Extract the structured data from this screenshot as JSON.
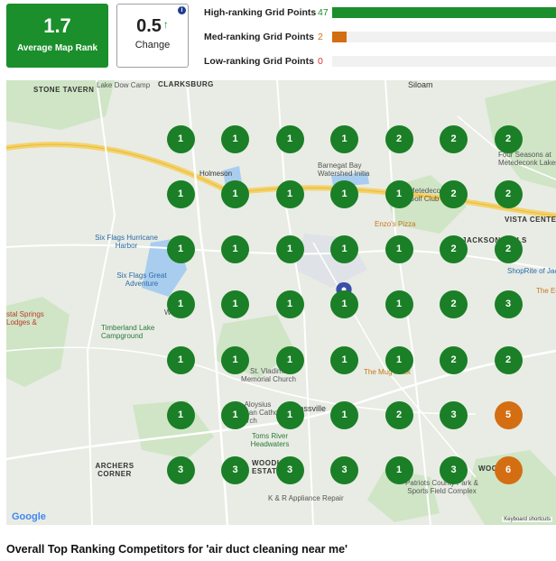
{
  "stats": {
    "avg_rank": {
      "value": "1.7",
      "label": "Average Map Rank"
    },
    "change": {
      "value": "0.5",
      "label": "Change",
      "info": "i"
    }
  },
  "legend": [
    {
      "label": "High-ranking Grid Points",
      "count": "47",
      "fraction": 1.0,
      "color": "#1a8f2b"
    },
    {
      "label": "Med-ranking Grid Points",
      "count": "2",
      "fraction": 0.065,
      "color": "#d46e12"
    },
    {
      "label": "Low-ranking Grid Points",
      "count": "0",
      "fraction": 0,
      "color": "#d9342b"
    }
  ],
  "map": {
    "labels": [
      {
        "text": "STONE TAVERN",
        "kind": "dark"
      },
      {
        "text": "Lake Dow Camp",
        "kind": ""
      },
      {
        "text": "CLARKSBURG",
        "kind": "dark"
      },
      {
        "text": "Siloam",
        "kind": ""
      },
      {
        "text": "Holmeson",
        "kind": ""
      },
      {
        "text": "Barnegat Bay Watershed Initia",
        "kind": ""
      },
      {
        "text": "Four Seasons at Metedeconk Lakes",
        "kind": ""
      },
      {
        "text": "Metedeconk Golf Club",
        "kind": ""
      },
      {
        "text": "VISTA CENTER",
        "kind": "dark"
      },
      {
        "text": "Enzo's Pizza",
        "kind": "orange"
      },
      {
        "text": "Six Flags Hurricane Harbor",
        "kind": "blue"
      },
      {
        "text": "JACKSON MILLS",
        "kind": "dark"
      },
      {
        "text": "ShopRite of Jackson",
        "kind": "blue"
      },
      {
        "text": "Six Flags Great Adventure",
        "kind": "blue"
      },
      {
        "text": "The Ed",
        "kind": "orange"
      },
      {
        "text": "stal Springs Lodges &",
        "kind": ""
      },
      {
        "text": "Wildlife",
        "kind": ""
      },
      {
        "text": "Timberland Lake Campground",
        "kind": ""
      },
      {
        "text": "St. Vladimir Memorial Church",
        "kind": ""
      },
      {
        "text": "The Mug Rack",
        "kind": "orange"
      },
      {
        "text": "St. Aloysius Roman Catholic Church",
        "kind": ""
      },
      {
        "text": "Cassville",
        "kind": ""
      },
      {
        "text": "Toms River Headwaters",
        "kind": ""
      },
      {
        "text": "ARCHERS CORNER",
        "kind": "dark"
      },
      {
        "text": "WOODLAND ESTATES",
        "kind": "dark"
      },
      {
        "text": "Patriots County Park & Sports Field Complex",
        "kind": ""
      },
      {
        "text": "K & R Appliance Repair",
        "kind": ""
      },
      {
        "text": "WOOD",
        "kind": "dark"
      }
    ],
    "google_logo": "Google",
    "keyboard_shortcuts": "Keyboard shortcuts",
    "grid": [
      [
        "1",
        "1",
        "1",
        "1",
        "2",
        "2",
        "2"
      ],
      [
        "1",
        "1",
        "1",
        "1",
        "1",
        "2",
        "2"
      ],
      [
        "1",
        "1",
        "1",
        "1",
        "1",
        "2",
        "2"
      ],
      [
        "1",
        "1",
        "1",
        "1",
        "1",
        "2",
        "3"
      ],
      [
        "1",
        "1",
        "1",
        "1",
        "1",
        "2",
        "2"
      ],
      [
        "1",
        "1",
        "1",
        "1",
        "2",
        "3",
        "5"
      ],
      [
        "3",
        "3",
        "3",
        "3",
        "1",
        "3",
        "6"
      ]
    ],
    "colors": {
      "high": "#1a7f26",
      "med": "#d46e12"
    }
  },
  "bottom_title": "Overall Top Ranking Competitors for 'air duct cleaning near me'"
}
